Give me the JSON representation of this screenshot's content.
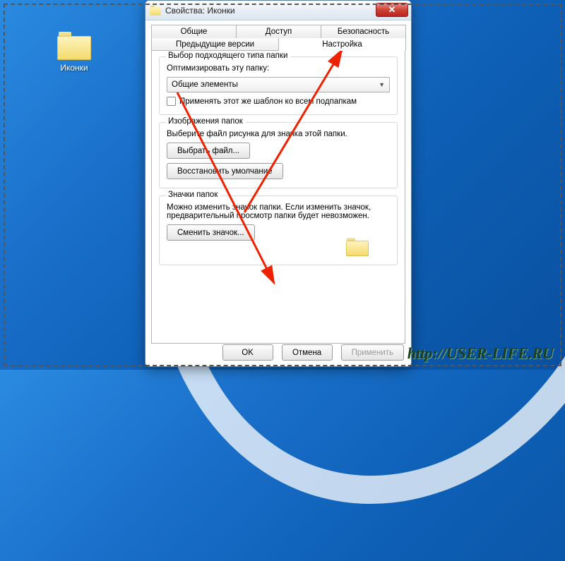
{
  "desktop": {
    "icon_label": "Иконки"
  },
  "dialog": {
    "title": "Свойства: Иконки",
    "tabs_row1": [
      "Общие",
      "Доступ",
      "Безопасность"
    ],
    "tabs_row2": [
      "Предыдущие версии",
      "Настройка"
    ],
    "active_tab": "Настройка",
    "group1": {
      "legend": "Выбор подходящего типа папки",
      "optimize_label": "Оптимизировать эту папку:",
      "select_value": "Общие элементы",
      "checkbox_label": "Применять этот же шаблон ко всем подпапкам"
    },
    "group2": {
      "legend": "Изображения папок",
      "text": "Выберите файл рисунка для значка этой папки.",
      "choose_btn": "Выбрать файл...",
      "restore_btn": "Восстановить умолчание"
    },
    "group3": {
      "legend": "Значки папок",
      "text": "Можно изменить значок папки. Если изменить значок, предварительный просмотр папки будет невозможен.",
      "change_btn": "Сменить значок..."
    },
    "actions": {
      "ok": "OK",
      "cancel": "Отмена",
      "apply": "Применить"
    }
  },
  "watermark": "http://user-life.ru"
}
